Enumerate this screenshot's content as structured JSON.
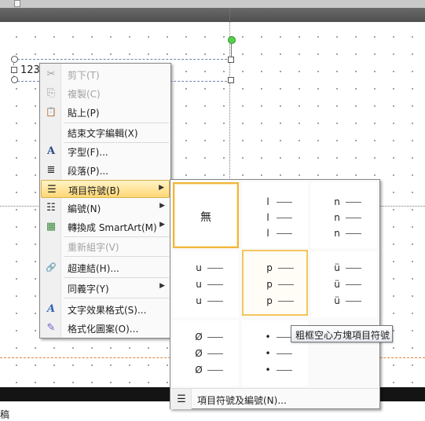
{
  "slide": {
    "textbox_text": "123",
    "bottom_text": "稿"
  },
  "context_menu": {
    "items": [
      {
        "icon": "cut-icon",
        "glyph": "✂",
        "label": "剪下(T)",
        "disabled": true
      },
      {
        "icon": "copy-icon",
        "glyph": "⎘",
        "label": "複製(C)",
        "disabled": true
      },
      {
        "icon": "paste-icon",
        "glyph": "📋",
        "label": "貼上(P)",
        "disabled": false
      },
      {
        "icon": "",
        "glyph": "",
        "label": "結束文字編輯(X)",
        "disabled": false
      },
      {
        "icon": "font-icon",
        "glyph": "A",
        "label": "字型(F)...",
        "disabled": false
      },
      {
        "icon": "paragraph-icon",
        "glyph": "≣",
        "label": "段落(P)...",
        "disabled": false
      },
      {
        "icon": "bullets-icon",
        "glyph": "☰",
        "label": "項目符號(B)",
        "disabled": false,
        "submenu": true,
        "highlighted": true
      },
      {
        "icon": "numbering-icon",
        "glyph": "☷",
        "label": "編號(N)",
        "disabled": false,
        "submenu": true
      },
      {
        "icon": "smartart-icon",
        "glyph": "▦",
        "label": "轉換成 SmartArt(M)",
        "disabled": false,
        "submenu": true
      },
      {
        "icon": "",
        "glyph": "",
        "label": "重新組字(V)",
        "disabled": true
      },
      {
        "icon": "hyperlink-icon",
        "glyph": "🔗",
        "label": "超連結(H)...",
        "disabled": false
      },
      {
        "icon": "",
        "glyph": "",
        "label": "同義字(Y)",
        "disabled": false,
        "submenu": true
      },
      {
        "icon": "text-effects-icon",
        "glyph": "A",
        "label": "文字效果格式(S)...",
        "disabled": false
      },
      {
        "icon": "format-shape-icon",
        "glyph": "✎",
        "label": "格式化圖案(O)...",
        "disabled": false
      }
    ]
  },
  "bullets_gallery": {
    "none_label": "無",
    "options": [
      {
        "glyph": "l"
      },
      {
        "glyph": "n"
      },
      {
        "glyph": "u"
      },
      {
        "glyph": "p"
      },
      {
        "glyph": "ü"
      },
      {
        "glyph": "Ø"
      },
      {
        "glyph": "•"
      }
    ],
    "footer_label": "項目符號及編號(N)..."
  },
  "tooltip": "粗框空心方塊項目符號",
  "colors": {
    "highlight": "#ffd774",
    "selection_border": "#f0b63e",
    "rotation_handle": "#57d14a",
    "guide_orange": "#e0843a"
  }
}
